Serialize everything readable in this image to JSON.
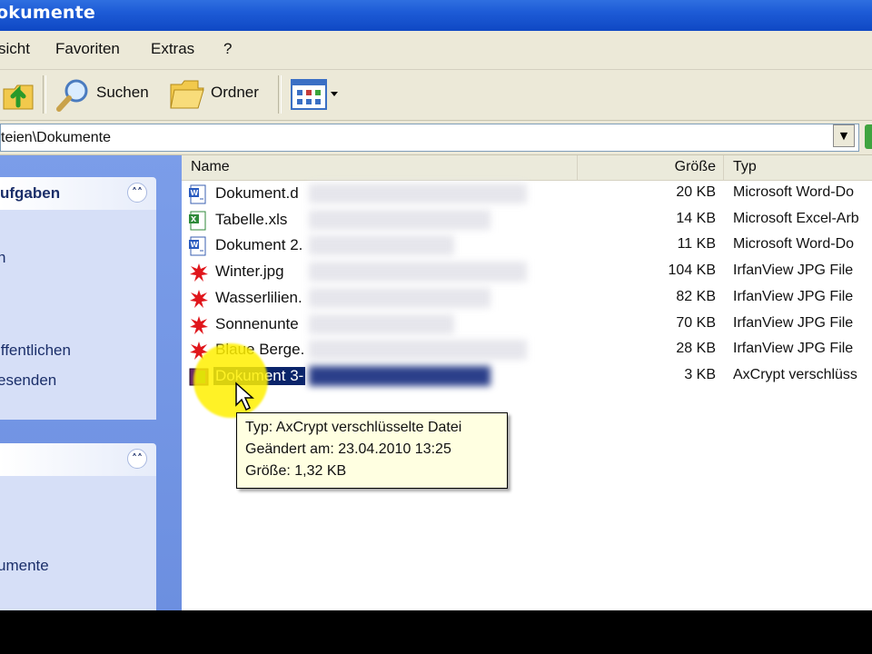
{
  "window": {
    "title": "okumente"
  },
  "menu": {
    "items": [
      "sicht",
      "Favoriten",
      "Extras",
      "?"
    ]
  },
  "toolbar": {
    "search_label": "Suchen",
    "folders_label": "Ordner"
  },
  "address": {
    "value": "teien\\Dokumente"
  },
  "taskpane": {
    "panel1": {
      "header": "ufgaben",
      "items": [
        "n",
        "iffentlichen",
        "esenden"
      ]
    },
    "panel2": {
      "header": "",
      "items": [
        "umente"
      ]
    }
  },
  "filelist": {
    "columns": {
      "name": "Name",
      "size": "Größe",
      "type": "Typ"
    },
    "rows": [
      {
        "name": "Dokument.d",
        "size": "20 KB",
        "type": "Microsoft Word-Do",
        "icon": "word-doc-icon"
      },
      {
        "name": "Tabelle.xls",
        "size": "14 KB",
        "type": "Microsoft Excel-Arb",
        "icon": "excel-icon"
      },
      {
        "name": "Dokument 2.",
        "size": "11 KB",
        "type": "Microsoft Word-Do",
        "icon": "word-doc-icon"
      },
      {
        "name": "Winter.jpg",
        "size": "104 KB",
        "type": "IrfanView JPG File",
        "icon": "irfanview-icon"
      },
      {
        "name": "Wasserlilien.",
        "size": "82 KB",
        "type": "IrfanView JPG File",
        "icon": "irfanview-icon"
      },
      {
        "name": "Sonnenunte",
        "size": "70 KB",
        "type": "IrfanView JPG File",
        "icon": "irfanview-icon"
      },
      {
        "name": "Blaue Berge.",
        "size": "28 KB",
        "type": "IrfanView JPG File",
        "icon": "irfanview-icon"
      },
      {
        "name": "Dokument 3-",
        "size": "3 KB",
        "type": "AxCrypt verschlüss",
        "icon": "axcrypt-icon"
      }
    ]
  },
  "tooltip": {
    "line1": "Typ: AxCrypt verschlüsselte Datei",
    "line2": "Geändert am: 23.04.2010 13:25",
    "line3": "Größe: 1,32 KB"
  },
  "colors": {
    "titlebar": "#1d5bd6",
    "selection": "#0a246a",
    "highlight": "#fff000",
    "tooltip_bg": "#ffffe1"
  }
}
